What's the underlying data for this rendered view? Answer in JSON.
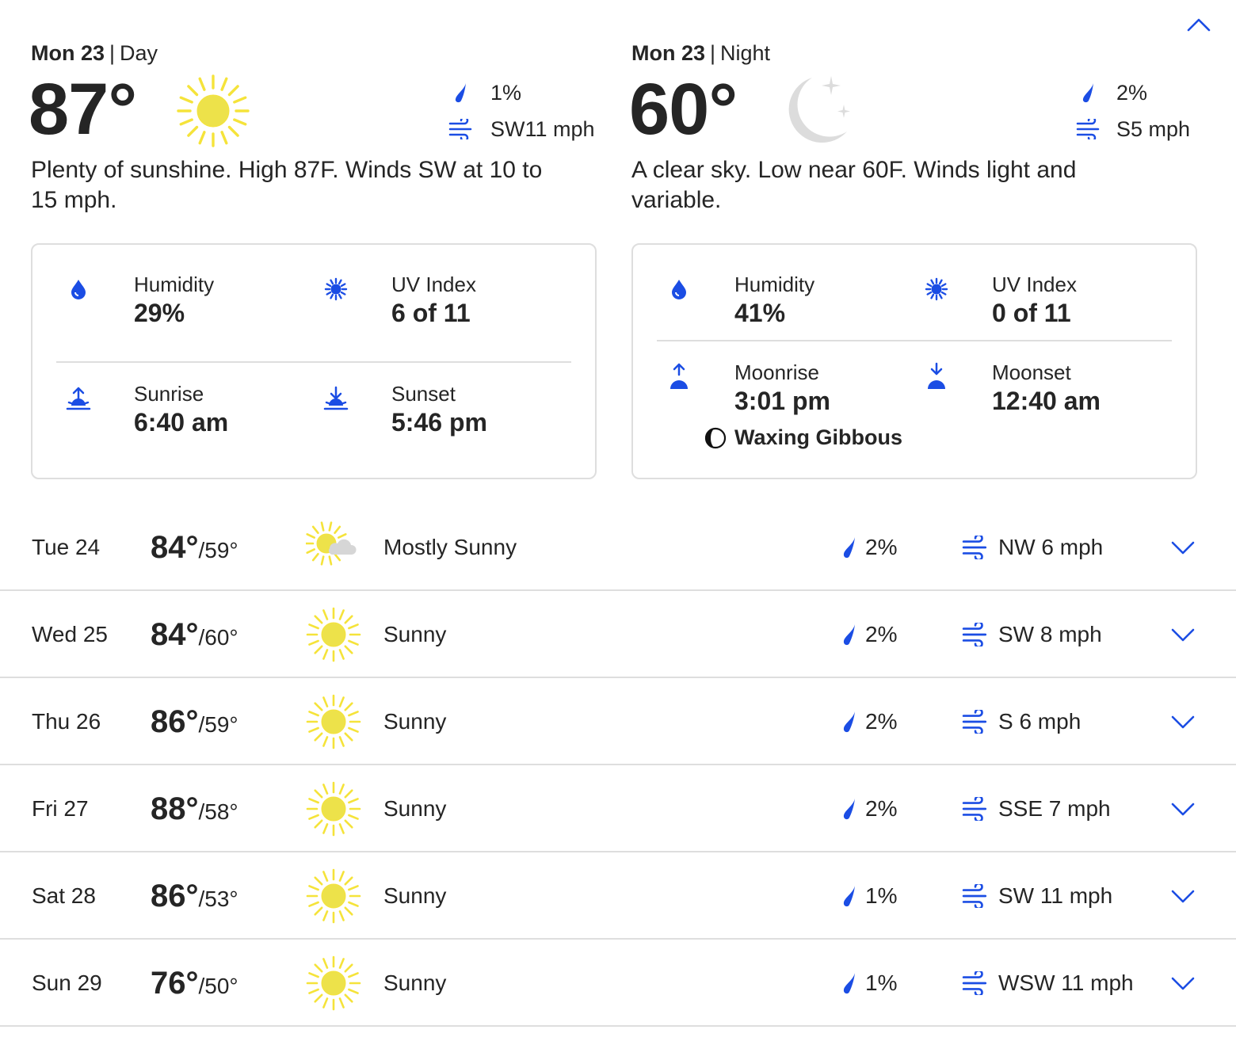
{
  "day": {
    "date": "Mon 23",
    "part": "Day",
    "temp": "87°",
    "icon": "sun-icon",
    "precip": "1%",
    "wind": "SW11 mph",
    "narrative": "Plenty of sunshine. High 87F. Winds SW at 10 to 15 mph.",
    "humidity_label": "Humidity",
    "humidity": "29%",
    "uv_label": "UV Index",
    "uv": "6 of 11",
    "sunrise_label": "Sunrise",
    "sunrise": "6:40 am",
    "sunset_label": "Sunset",
    "sunset": "5:46 pm"
  },
  "night": {
    "date": "Mon 23",
    "part": "Night",
    "temp": "60°",
    "icon": "moon-stars-icon",
    "precip": "2%",
    "wind": "S5 mph",
    "narrative": "A clear sky. Low near 60F. Winds light and variable.",
    "humidity_label": "Humidity",
    "humidity": "41%",
    "uv_label": "UV Index",
    "uv": "0 of 11",
    "moonrise_label": "Moonrise",
    "moonrise": "3:01 pm",
    "moonset_label": "Moonset",
    "moonset": "12:40 am",
    "moon_phase": "Waxing Gibbous"
  },
  "forecast": [
    {
      "day": "Tue 24",
      "hi": "84°",
      "lo": "/59°",
      "icon": "mostly-sunny-icon",
      "phrase": "Mostly Sunny",
      "precip": "2%",
      "wind": "NW 6 mph"
    },
    {
      "day": "Wed 25",
      "hi": "84°",
      "lo": "/60°",
      "icon": "sun-icon",
      "phrase": "Sunny",
      "precip": "2%",
      "wind": "SW 8 mph"
    },
    {
      "day": "Thu 26",
      "hi": "86°",
      "lo": "/59°",
      "icon": "sun-icon",
      "phrase": "Sunny",
      "precip": "2%",
      "wind": "S 6 mph"
    },
    {
      "day": "Fri 27",
      "hi": "88°",
      "lo": "/58°",
      "icon": "sun-icon",
      "phrase": "Sunny",
      "precip": "2%",
      "wind": "SSE 7 mph"
    },
    {
      "day": "Sat 28",
      "hi": "86°",
      "lo": "/53°",
      "icon": "sun-icon",
      "phrase": "Sunny",
      "precip": "1%",
      "wind": "SW 11 mph"
    },
    {
      "day": "Sun 29",
      "hi": "76°",
      "lo": "/50°",
      "icon": "sun-icon",
      "phrase": "Sunny",
      "precip": "1%",
      "wind": "WSW 11 mph"
    }
  ],
  "colors": {
    "accent": "#1b4de4",
    "sun": "#f5e33a",
    "text": "#252525",
    "border": "#dedede",
    "moon": "#d9d9d9"
  }
}
